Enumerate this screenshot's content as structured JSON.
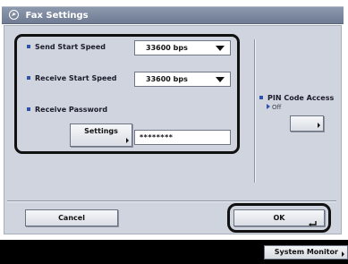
{
  "title": "Fax Settings",
  "settings": {
    "send_start_speed": {
      "label": "Send Start Speed",
      "value": "33600 bps"
    },
    "receive_start_speed": {
      "label": "Receive Start Speed",
      "value": "33600 bps"
    },
    "receive_password": {
      "label": "Receive Password",
      "button_label": "Settings",
      "value": "********"
    }
  },
  "pin_code_access": {
    "label": "PIN Code Access",
    "status": "Off"
  },
  "buttons": {
    "cancel": "Cancel",
    "ok": "OK"
  },
  "status_bar": {
    "system_monitor": "System Monitor"
  },
  "colors": {
    "title_bar": "#7f8ba2",
    "panel": "#cfd4de",
    "bullet": "#2f52a8",
    "status_bar": "#000000"
  },
  "icons": {
    "title": "fax-icon",
    "dropdown": "triangle-down-icon",
    "ok": "return-icon",
    "button_arrow": "triangle-right-icon"
  }
}
